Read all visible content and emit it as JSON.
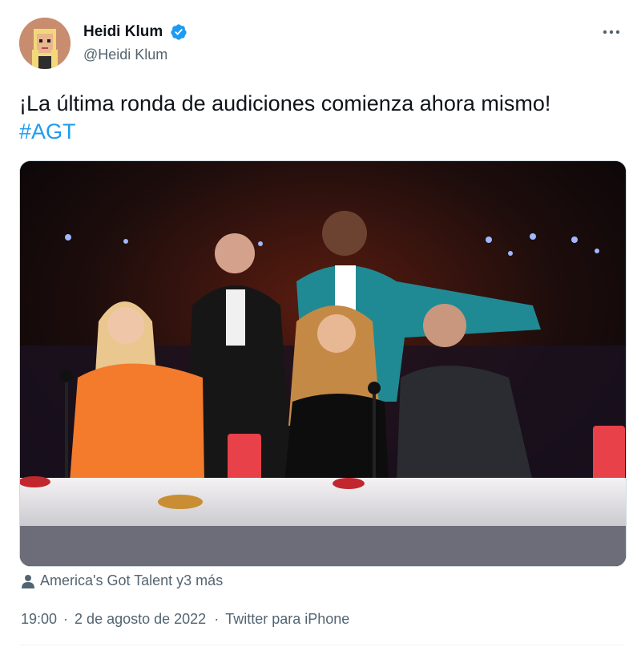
{
  "tweet": {
    "author": {
      "display_name": "Heidi Klum",
      "handle": "@Heidi Klum",
      "verified": true,
      "avatar_icon": "pixel-art-avatar"
    },
    "text": "¡La última ronda de audiciones comienza ahora mismo!",
    "hashtag": "#AGT",
    "media": {
      "description_icon": "photo"
    },
    "tagged": "America's Got Talent y3 más",
    "time": "19:00",
    "date": "2 de agosto de 2022",
    "source": "Twitter para iPhone"
  },
  "colors": {
    "link": "#1d9bf0",
    "muted": "#536471",
    "verified": "#1d9bf0"
  },
  "icons": [
    "verified-badge-icon",
    "more-options-icon",
    "user-tag-icon"
  ]
}
